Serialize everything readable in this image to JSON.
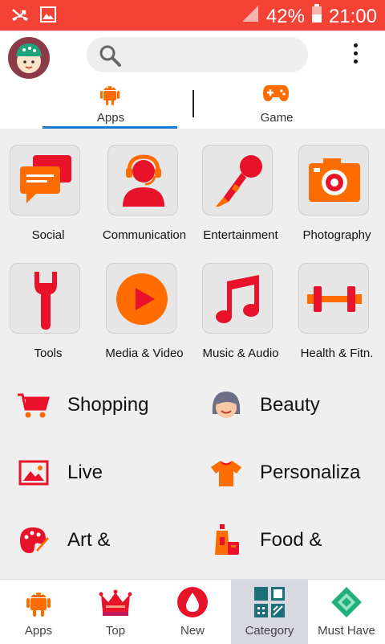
{
  "status_bar": {
    "battery": "42%",
    "time": "21:00"
  },
  "search": {
    "placeholder": ""
  },
  "tabs": [
    {
      "label": "Apps",
      "selected": true
    },
    {
      "label": "Game",
      "selected": false
    }
  ],
  "categories_grid": [
    {
      "label": "Social",
      "icon": "chat-bubbles-icon"
    },
    {
      "label": "Communication",
      "icon": "headset-person-icon"
    },
    {
      "label": "Entertainment",
      "icon": "microphone-icon"
    },
    {
      "label": "Photography",
      "icon": "camera-icon"
    },
    {
      "label": "Tools",
      "icon": "wrench-icon"
    },
    {
      "label": "Media & Video",
      "icon": "play-button-icon"
    },
    {
      "label": "Music & Audio",
      "icon": "music-note-icon"
    },
    {
      "label": "Health & Fitn.",
      "icon": "dumbbell-icon"
    }
  ],
  "categories_list": [
    {
      "label": "Shopping",
      "icon": "shopping-cart-icon"
    },
    {
      "label": "Beauty",
      "icon": "woman-face-icon"
    },
    {
      "label": "Live",
      "icon": "picture-icon"
    },
    {
      "label": "Personaliza",
      "icon": "tshirt-icon"
    },
    {
      "label": "Art &",
      "icon": "palette-icon"
    },
    {
      "label": "Food &",
      "icon": "drinks-icon"
    }
  ],
  "bottom_nav": [
    {
      "label": "Apps",
      "icon": "android-icon",
      "active": false
    },
    {
      "label": "Top",
      "icon": "crown-icon",
      "active": false
    },
    {
      "label": "New",
      "icon": "drop-icon",
      "active": false
    },
    {
      "label": "Category",
      "icon": "category-grid-icon",
      "active": true
    },
    {
      "label": "Must Have",
      "icon": "diamond-icon",
      "active": false
    }
  ],
  "colors": {
    "status_bar": "#f44336",
    "accent_orange": "#ff6d00",
    "accent_red": "#e8132a",
    "tab_underline": "#1a7ad4"
  }
}
